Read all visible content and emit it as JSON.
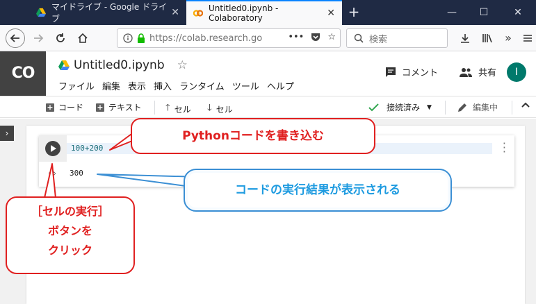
{
  "browser": {
    "tabs": [
      {
        "title": "マイドライブ - Google ドライブ",
        "close": "✕"
      },
      {
        "title": "Untitled0.ipynb - Colaboratory",
        "close": "✕"
      }
    ],
    "new_tab": "+",
    "window_controls": {
      "minimize": "—",
      "maximize": "☐",
      "close": "✕"
    },
    "url": "https://colab.research.go",
    "url_more": "•••",
    "search_placeholder": "検索"
  },
  "colab": {
    "logo": "CO",
    "doc_title": "Untitled0.ipynb",
    "star": "☆",
    "menu": [
      "ファイル",
      "編集",
      "表示",
      "挿入",
      "ランタイム",
      "ツール",
      "ヘルプ"
    ],
    "comment_label": "コメント",
    "share_label": "共有",
    "avatar_letter": "I",
    "toolbar": {
      "add_code": "コード",
      "add_text": "テキスト",
      "cell_up": "セル",
      "cell_down": "セル",
      "connected": "接続済み",
      "editing": "編集中"
    }
  },
  "cell": {
    "code": "100+200",
    "output": "300"
  },
  "callouts": {
    "code_hint": "Pythonコードを書き込む",
    "result_hint": "コードの実行結果が表示される",
    "run_hint_line1": "［セルの実行］",
    "run_hint_line2": "ボタンを",
    "run_hint_line3": "クリック"
  },
  "colors": {
    "tabbar": "#1f2a44",
    "callout_red": "#e02020",
    "callout_blue": "#1e9be0",
    "avatar": "#00796b",
    "connected_check": "#34a853"
  }
}
